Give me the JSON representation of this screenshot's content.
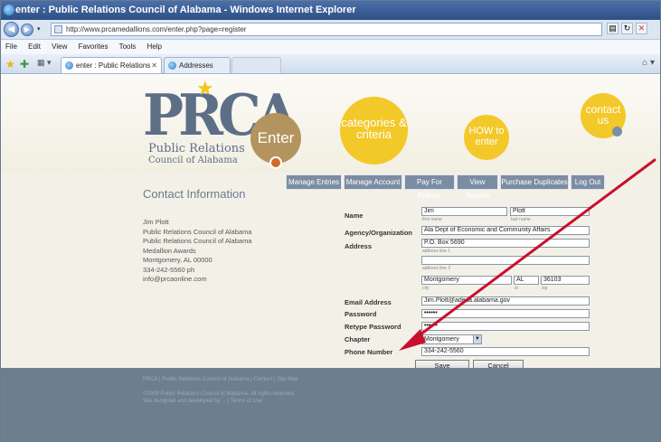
{
  "window": {
    "title": "enter : Public Relations Council of Alabama - Windows Internet Explorer"
  },
  "address_bar": {
    "url": "http://www.prcamedallions.com/enter.php?page=register",
    "back_label": "◀",
    "forward_label": "▶"
  },
  "menu": [
    "File",
    "Edit",
    "View",
    "Favorites",
    "Tools",
    "Help"
  ],
  "tabs": [
    {
      "label": "enter : Public Relations C...",
      "active": true
    },
    {
      "label": "Addresses",
      "active": false
    }
  ],
  "site": {
    "logo_text": "PRCA",
    "logo_line1": "Public Relations",
    "logo_line2": "Council of Alabama",
    "circles": {
      "enter": "Enter",
      "categories": "categories & criteria",
      "how": "HOW to enter",
      "contact": "contact us"
    },
    "nav": [
      "Manage Entries",
      "Manage Account",
      "Pay For Entries",
      "View Awards",
      "Purchase Duplicates",
      "Log Out"
    ]
  },
  "contact": {
    "title": "Contact Information",
    "lines": [
      "Jim Plott",
      "Public Relations Council of Alabama",
      "Public Relations Council of Alabama",
      "Medallion Awards",
      "Montgomery, AL 00000",
      "334-242-5560 ph",
      "info@prcaonline.com"
    ]
  },
  "form": {
    "name_label": "Name",
    "first_name": "Jim",
    "first_name_sub": "first name",
    "last_name": "Plott",
    "last_name_sub": "last name",
    "agency_label": "Agency/Organization",
    "agency": "Ala Dept of Economic and Community Affairs",
    "address_label": "Address",
    "address1": "P.O. Box 5690",
    "address1_sub": "address line 1",
    "address2": "",
    "address2_sub": "address line 2",
    "city": "Montgomery",
    "city_sub": "city",
    "state": "AL",
    "state_sub": "st",
    "zip": "36103",
    "zip_sub": "zip",
    "email_label": "Email Address",
    "email": "Jim.Plott@adeca.alabama.gov",
    "password_label": "Password",
    "password": "••••••",
    "retype_label": "Retype Password",
    "retype": "••••••",
    "chapter_label": "Chapter",
    "chapter": "Montgomery",
    "phone_label": "Phone Number",
    "phone": "334-242-5560",
    "save": "Save",
    "cancel": "Cancel"
  },
  "footer": {
    "lines": [
      "PRCA | Public Relations Council of Alabama | Contact | Site Map",
      "©2009 Public Relations Council of Alabama. All rights reserved.",
      "Site designed and developed by ... | Terms of Use"
    ]
  },
  "annotation": {
    "arrow_color": "#c8102e"
  }
}
